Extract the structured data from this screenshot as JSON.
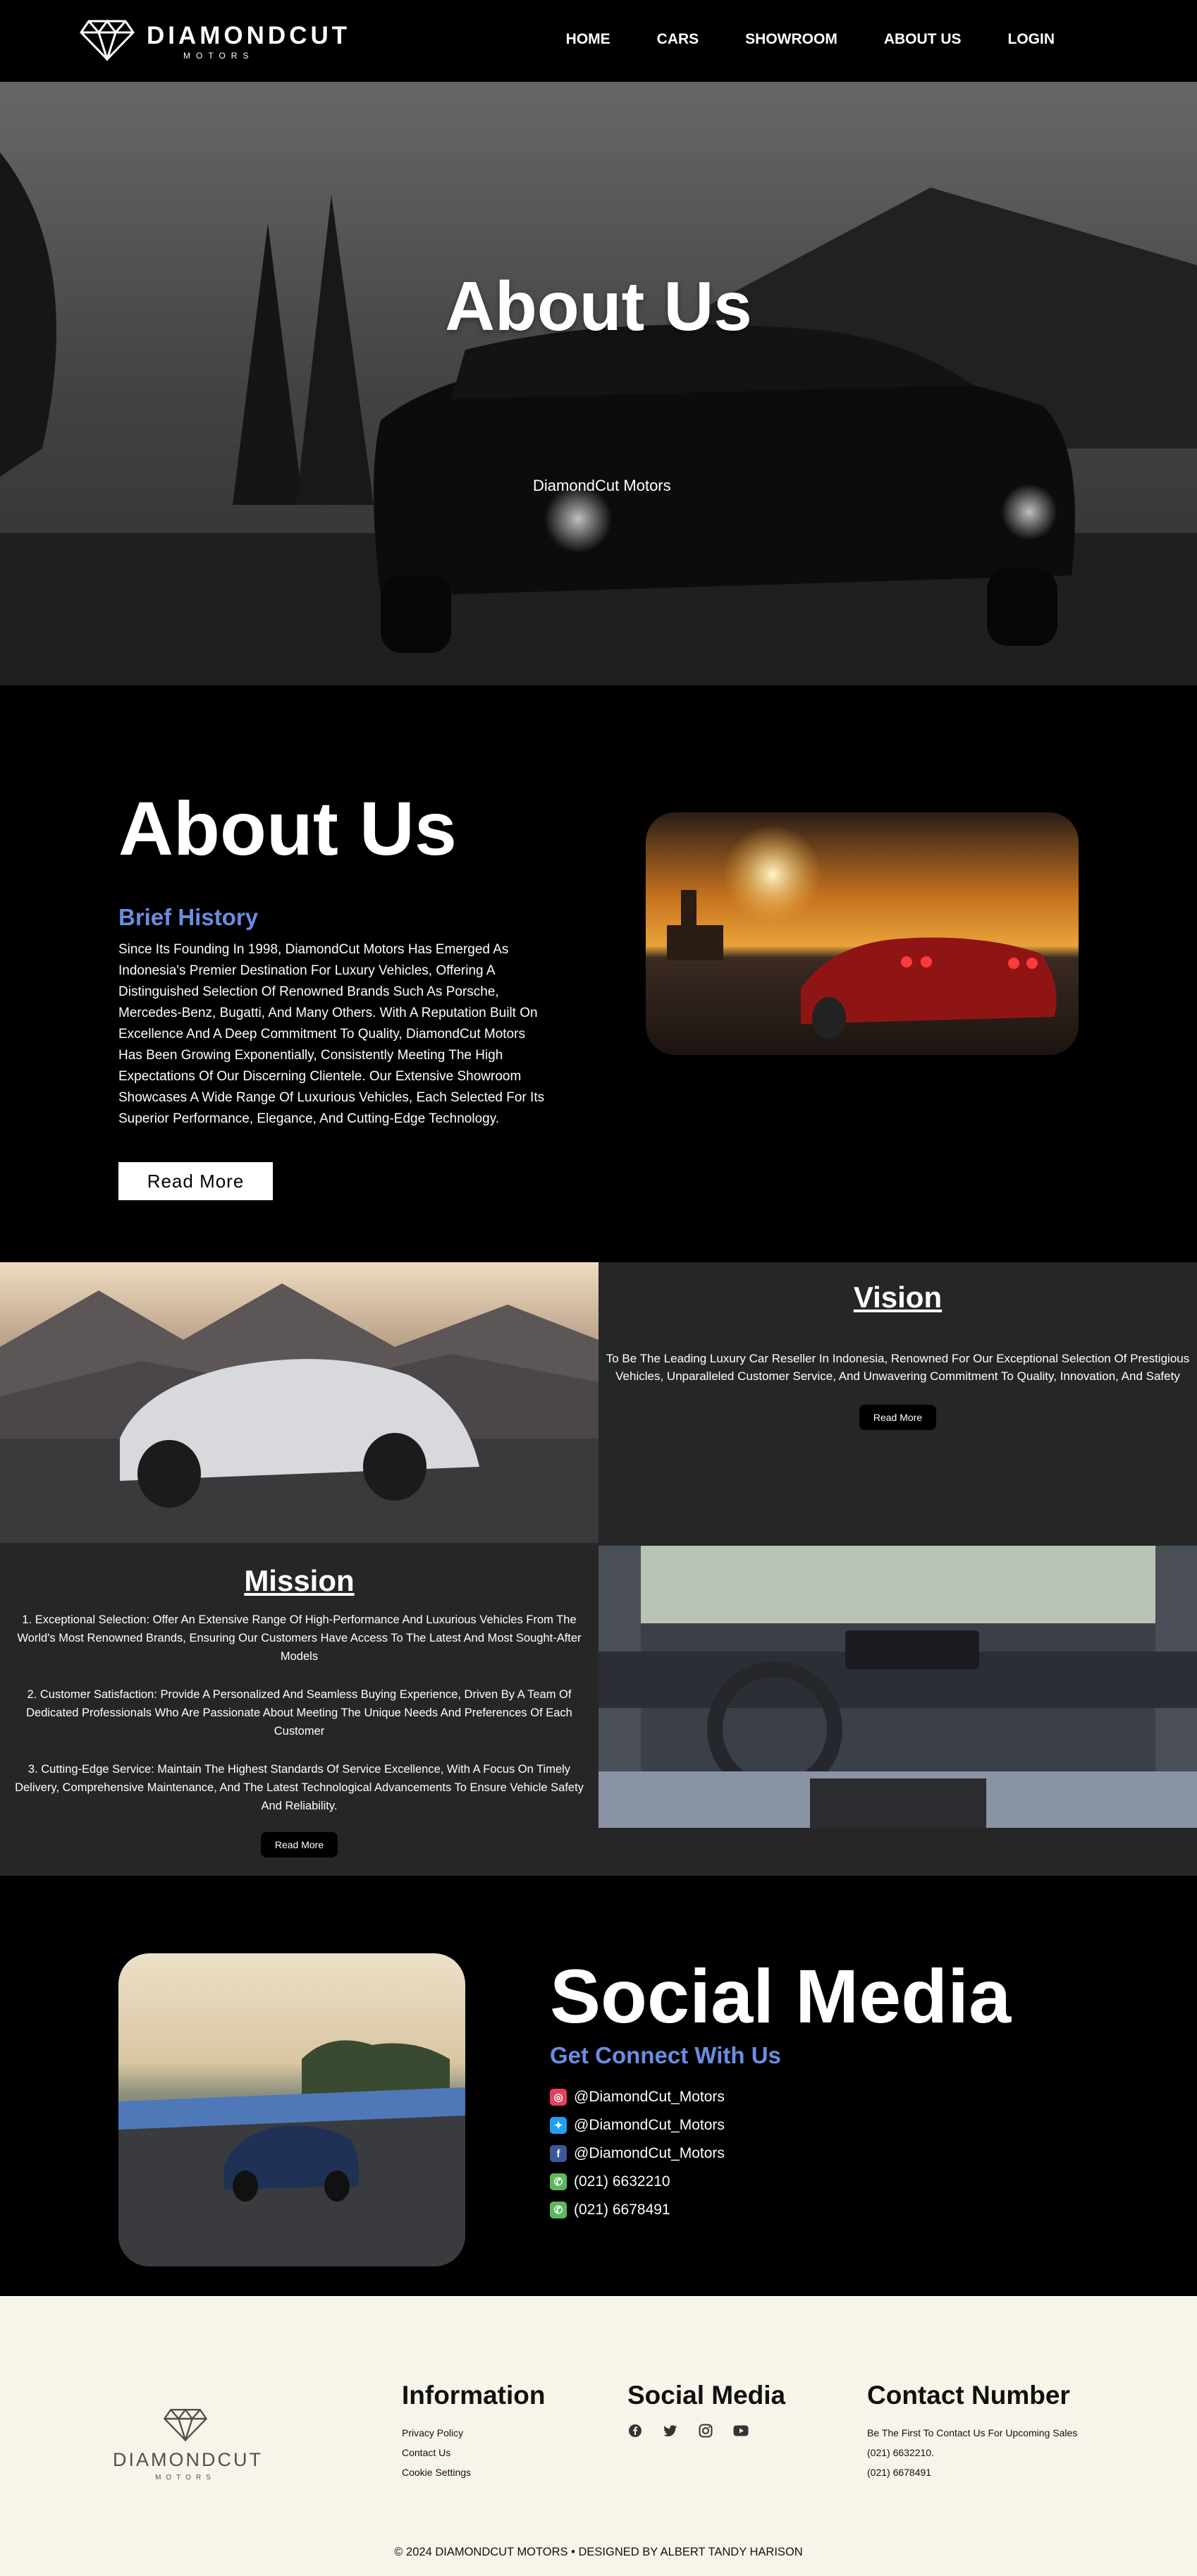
{
  "nav": {
    "brand": "DIAMONDCUT",
    "brand_sub": "MOTORS",
    "items": [
      "HOME",
      "CARS",
      "SHOWROOM",
      "ABOUT US",
      "LOGIN"
    ]
  },
  "hero": {
    "title": "About Us",
    "subtitle": "DiamondCut Motors"
  },
  "about": {
    "title": "About Us",
    "brief_heading": "Brief History",
    "text": "Since Its Founding In 1998, DiamondCut Motors Has Emerged As Indonesia's Premier Destination For Luxury Vehicles, Offering A Distinguished Selection Of Renowned Brands Such As Porsche, Mercedes-Benz, Bugatti, And Many Others. With A Reputation Built On Excellence And A Deep Commitment To Quality, DiamondCut Motors Has Been Growing Exponentially, Consistently Meeting The High Expectations Of Our Discerning Clientele. Our Extensive Showroom Showcases A Wide Range Of Luxurious Vehicles, Each Selected For Its Superior Performance, Elegance, And Cutting-Edge Technology.",
    "read_more": "Read More"
  },
  "vision": {
    "title": "Vision",
    "text": "To Be The Leading Luxury Car Reseller In Indonesia, Renowned For Our Exceptional Selection Of Prestigious Vehicles, Unparalleled Customer Service, And Unwavering Commitment To Quality, Innovation, And Safety",
    "read_more": "Read More"
  },
  "mission": {
    "title": "Mission",
    "items": [
      "1. Exceptional Selection: Offer An Extensive Range Of High-Performance And Luxurious Vehicles From The World's Most Renowned Brands, Ensuring Our Customers Have Access To The Latest And Most Sought-After Models",
      "2. Customer Satisfaction: Provide A Personalized And Seamless Buying Experience, Driven By A Team Of Dedicated Professionals Who Are Passionate About Meeting The Unique Needs And Preferences Of Each Customer",
      "3. Cutting-Edge Service: Maintain The Highest Standards Of Service Excellence, With A Focus On Timely Delivery, Comprehensive Maintenance, And The Latest Technological Advancements To Ensure Vehicle Safety And Reliability."
    ],
    "read_more": "Read More"
  },
  "social": {
    "title": "Social Media",
    "connect": "Get Connect With Us",
    "items": [
      {
        "icon": "instagram-icon",
        "text": "@DiamondCut_Motors",
        "color": "#e4405f"
      },
      {
        "icon": "twitter-icon",
        "text": "@DiamondCut_Motors",
        "color": "#1da1f2"
      },
      {
        "icon": "facebook-icon",
        "text": "@DiamondCut_Motors",
        "color": "#3b5998"
      },
      {
        "icon": "phone-icon",
        "text": "(021) 6632210",
        "color": "#5cb85c"
      },
      {
        "icon": "phone-icon",
        "text": "(021) 6678491",
        "color": "#5cb85c"
      }
    ]
  },
  "footer": {
    "brand": "DIAMONDCUT",
    "brand_sub": "MOTORS",
    "info_title": "Information",
    "info_links": [
      "Privacy Policy",
      "Contact Us",
      "Cookie Settings"
    ],
    "social_title": "Social Media",
    "contact_title": "Contact Number",
    "contact_lines": [
      "Be The First To Contact Us For Upcoming Sales",
      "(021) 6632210.",
      "(021) 6678491"
    ],
    "copyright": "© 2024 DIAMONDCUT MOTORS • DESIGNED BY ALBERT TANDY HARISON"
  }
}
